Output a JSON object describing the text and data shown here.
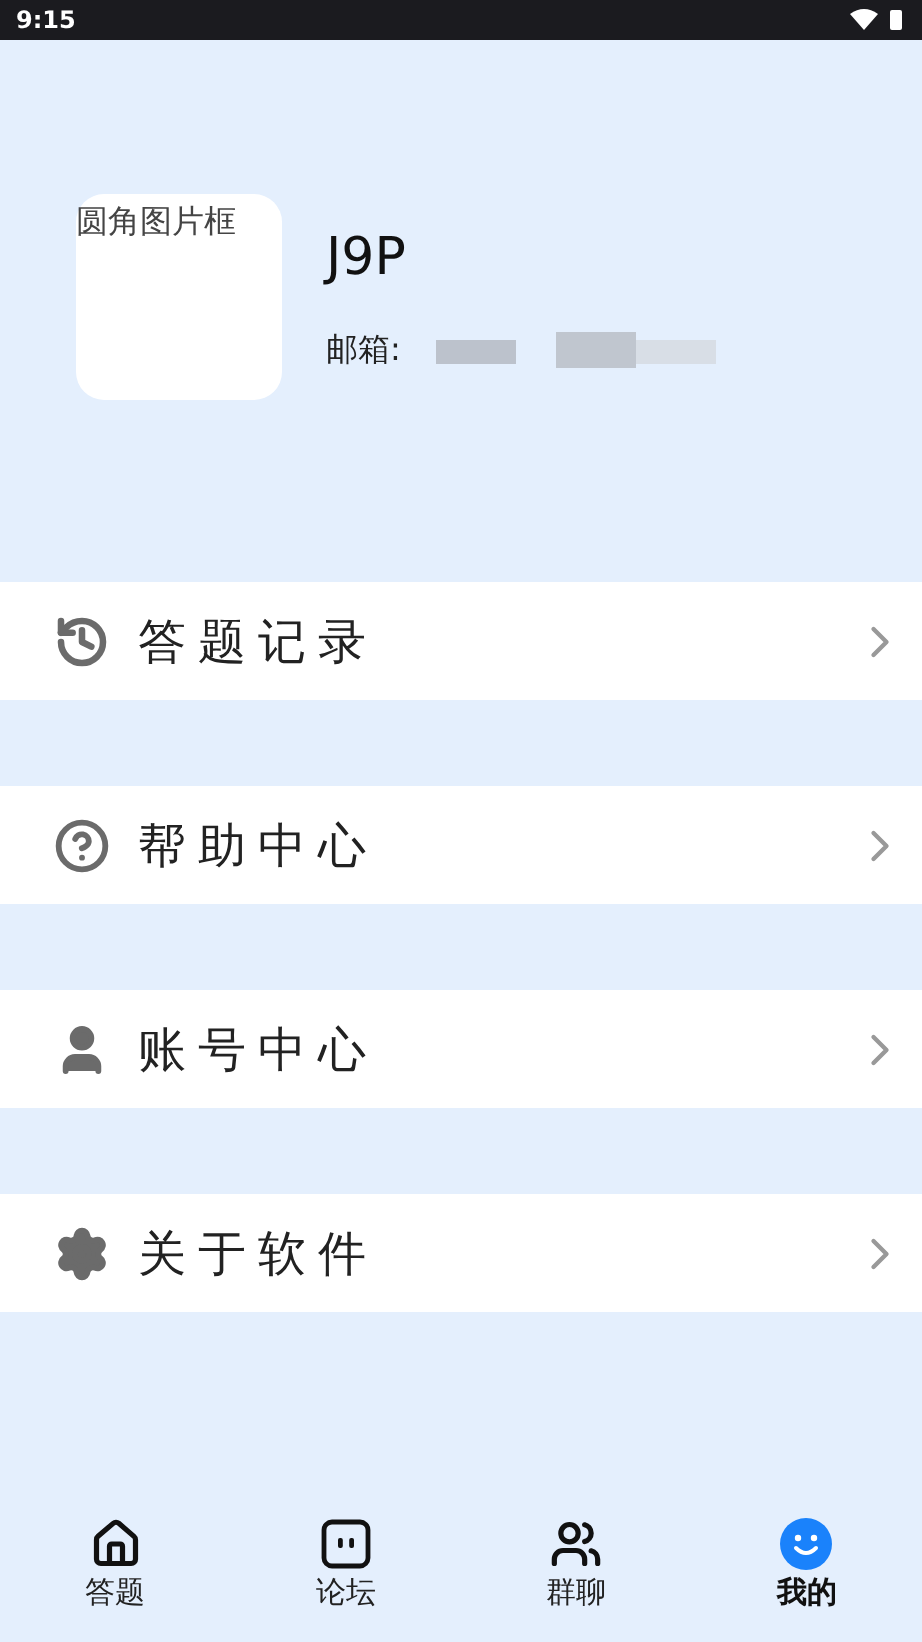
{
  "status_bar": {
    "time": "9:15"
  },
  "profile": {
    "avatar_alt": "圆角图片框",
    "name": "J9P",
    "email_label": "邮箱:"
  },
  "menu": [
    {
      "kind": "history",
      "label": "答题记录"
    },
    {
      "kind": "help",
      "label": "帮助中心"
    },
    {
      "kind": "account",
      "label": "账号中心"
    },
    {
      "kind": "settings",
      "label": "关于软件"
    }
  ],
  "bottom_nav": [
    {
      "kind": "home",
      "label": "答题",
      "selected": false
    },
    {
      "kind": "forum",
      "label": "论坛",
      "selected": false
    },
    {
      "kind": "group",
      "label": "群聊",
      "selected": false
    },
    {
      "kind": "me",
      "label": "我的",
      "selected": true
    }
  ]
}
